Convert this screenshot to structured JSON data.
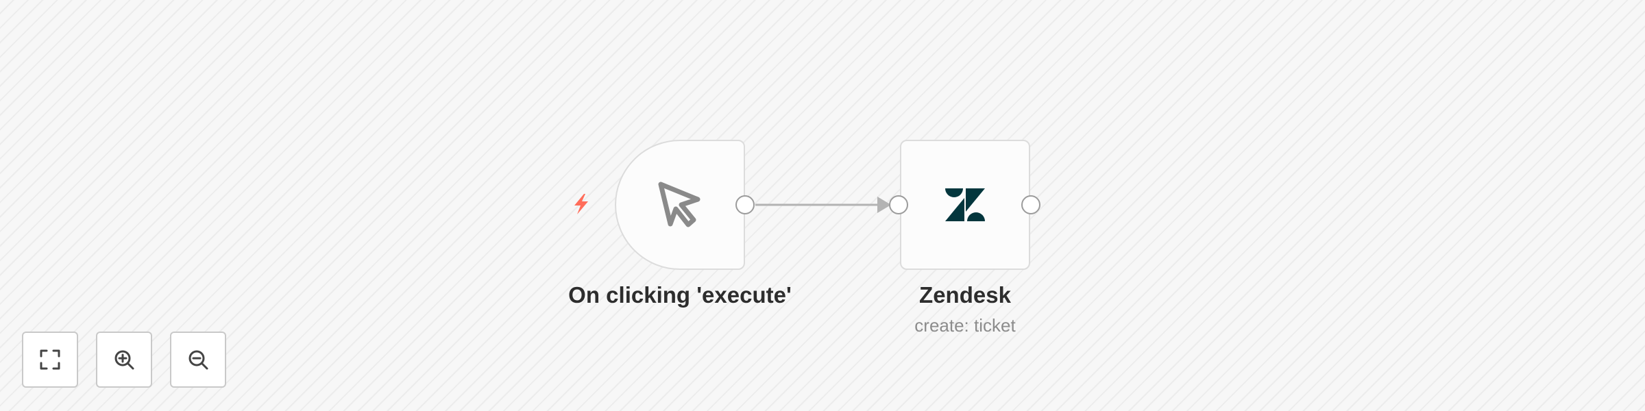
{
  "canvas": {
    "background": "#f7f7f7",
    "stripe_color": "#ececec"
  },
  "nodes": [
    {
      "id": "trigger",
      "title": "On clicking 'execute'",
      "icon": "cursor-arrow-icon",
      "badge_icon": "lightning-bolt-icon",
      "badge_color": "#ff6d5a"
    },
    {
      "id": "zendesk",
      "title": "Zendesk",
      "subtitle": "create: ticket",
      "icon": "zendesk-logo-icon",
      "icon_color": "#03363d"
    }
  ],
  "controls": {
    "fit_view_icon": "fit-to-view-icon",
    "zoom_in_icon": "zoom-in-icon",
    "zoom_out_icon": "zoom-out-icon"
  }
}
